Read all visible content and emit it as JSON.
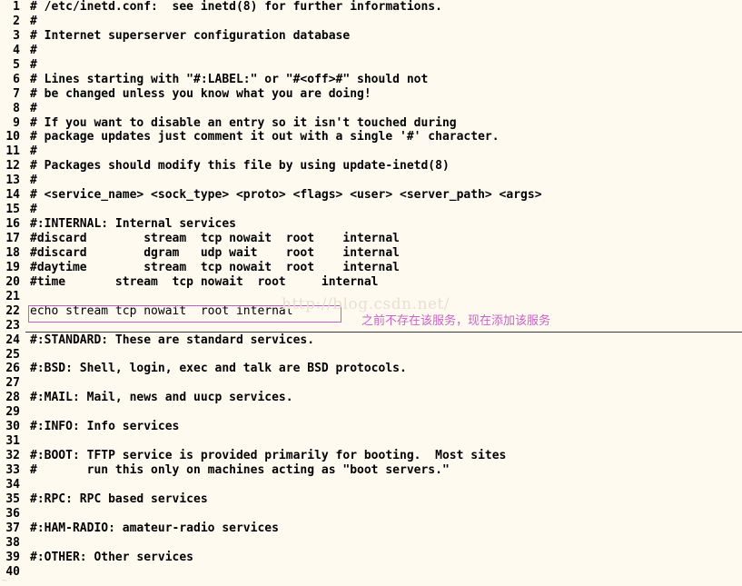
{
  "window": {
    "background_color": "#fffaf0",
    "text_color": "#000000",
    "title": "/etc/inetd.conf"
  },
  "watermark": {
    "text": "http://blog.csdn.net/",
    "color": "#e9dfd2"
  },
  "annotation": {
    "text": "之前不存在该服务，现在添加该服务",
    "color": "#c763c7"
  },
  "highlight": {
    "border_color": "#c060c0",
    "target_line": 22
  },
  "editor": {
    "lines": [
      {
        "n": "1",
        "text": "# /etc/inetd.conf:  see inetd(8) for further informations."
      },
      {
        "n": "2",
        "text": "#"
      },
      {
        "n": "3",
        "text": "# Internet superserver configuration database"
      },
      {
        "n": "4",
        "text": "#"
      },
      {
        "n": "5",
        "text": "#"
      },
      {
        "n": "6",
        "text": "# Lines starting with \"#:LABEL:\" or \"#<off>#\" should not"
      },
      {
        "n": "7",
        "text": "# be changed unless you know what you are doing!"
      },
      {
        "n": "8",
        "text": "#"
      },
      {
        "n": "9",
        "text": "# If you want to disable an entry so it isn't touched during"
      },
      {
        "n": "10",
        "text": "# package updates just comment it out with a single '#' character."
      },
      {
        "n": "11",
        "text": "#"
      },
      {
        "n": "12",
        "text": "# Packages should modify this file by using update-inetd(8)"
      },
      {
        "n": "13",
        "text": "#"
      },
      {
        "n": "14",
        "text": "# <service_name> <sock_type> <proto> <flags> <user> <server_path> <args>"
      },
      {
        "n": "15",
        "text": "#"
      },
      {
        "n": "16",
        "text": "#:INTERNAL: Internal services"
      },
      {
        "n": "17",
        "text": "#discard        stream  tcp nowait  root    internal"
      },
      {
        "n": "18",
        "text": "#discard        dgram   udp wait    root    internal"
      },
      {
        "n": "19",
        "text": "#daytime        stream  tcp nowait  root    internal"
      },
      {
        "n": "20",
        "text": "#time       stream  tcp nowait  root     internal"
      },
      {
        "n": "21",
        "text": ""
      },
      {
        "n": "22",
        "text": "echo stream tcp nowait  root internal",
        "added": true
      },
      {
        "n": "23",
        "text": ""
      },
      {
        "n": "24",
        "text": "#:STANDARD: These are standard services."
      },
      {
        "n": "25",
        "text": ""
      },
      {
        "n": "26",
        "text": "#:BSD: Shell, login, exec and talk are BSD protocols."
      },
      {
        "n": "27",
        "text": ""
      },
      {
        "n": "28",
        "text": "#:MAIL: Mail, news and uucp services."
      },
      {
        "n": "29",
        "text": ""
      },
      {
        "n": "30",
        "text": "#:INFO: Info services"
      },
      {
        "n": "31",
        "text": ""
      },
      {
        "n": "32",
        "text": "#:BOOT: TFTP service is provided primarily for booting.  Most sites"
      },
      {
        "n": "33",
        "text": "#       run this only on machines acting as \"boot servers.\""
      },
      {
        "n": "34",
        "text": ""
      },
      {
        "n": "35",
        "text": "#:RPC: RPC based services"
      },
      {
        "n": "36",
        "text": ""
      },
      {
        "n": "37",
        "text": "#:HAM-RADIO: amateur-radio services"
      },
      {
        "n": "38",
        "text": ""
      },
      {
        "n": "39",
        "text": "#:OTHER: Other services"
      },
      {
        "n": "40",
        "text": ""
      }
    ]
  }
}
